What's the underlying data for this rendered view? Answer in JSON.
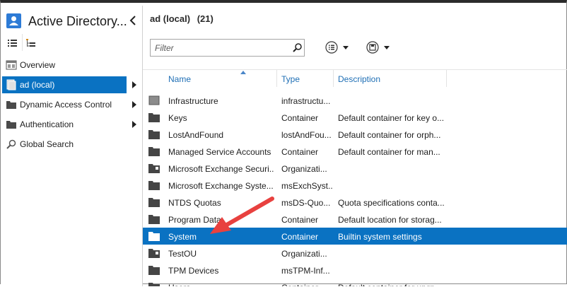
{
  "app": {
    "title": "Active Directory...",
    "collapse_glyph": "‹"
  },
  "nav": {
    "view_toggles": [
      "list-view-icon",
      "tree-view-icon"
    ],
    "items": [
      {
        "label": "Overview",
        "icon": "overview-icon",
        "has_arrow": false,
        "selected": false
      },
      {
        "label": "ad (local)",
        "icon": "domain-icon",
        "has_arrow": true,
        "selected": true
      },
      {
        "label": "Dynamic Access Control",
        "icon": "folder-icon",
        "has_arrow": true,
        "selected": false
      },
      {
        "label": "Authentication",
        "icon": "folder-icon",
        "has_arrow": true,
        "selected": false
      },
      {
        "label": "Global Search",
        "icon": "search-icon",
        "has_arrow": false,
        "selected": false
      }
    ]
  },
  "main": {
    "header_title": "ad (local)",
    "header_count": "(21)",
    "filter_placeholder": "Filter",
    "columns": {
      "name": "Name",
      "type": "Type",
      "description": "Description"
    },
    "rows": [
      {
        "icon": "builtin-domain-icon",
        "name": "Infrastructure",
        "type": "infrastructu...",
        "description": "",
        "selected": false
      },
      {
        "icon": "folder-icon",
        "name": "Keys",
        "type": "Container",
        "description": "Default container for key o...",
        "selected": false
      },
      {
        "icon": "folder-icon",
        "name": "LostAndFound",
        "type": "lostAndFou...",
        "description": "Default container for orph...",
        "selected": false
      },
      {
        "icon": "folder-icon",
        "name": "Managed Service Accounts",
        "type": "Container",
        "description": "Default container for man...",
        "selected": false
      },
      {
        "icon": "ou-icon",
        "name": "Microsoft Exchange Securi...",
        "type": "Organizati...",
        "description": "",
        "selected": false
      },
      {
        "icon": "folder-icon",
        "name": "Microsoft Exchange Syste...",
        "type": "msExchSyst...",
        "description": "",
        "selected": false
      },
      {
        "icon": "folder-icon",
        "name": "NTDS Quotas",
        "type": "msDS-Quo...",
        "description": "Quota specifications conta...",
        "selected": false
      },
      {
        "icon": "folder-icon",
        "name": "Program Data",
        "type": "Container",
        "description": "Default location for storag...",
        "selected": false
      },
      {
        "icon": "folder-icon",
        "name": "System",
        "type": "Container",
        "description": "Builtin system settings",
        "selected": true
      },
      {
        "icon": "ou-icon",
        "name": "TestOU",
        "type": "Organizati...",
        "description": "",
        "selected": false
      },
      {
        "icon": "folder-icon",
        "name": "TPM Devices",
        "type": "msTPM-Inf...",
        "description": "",
        "selected": false
      },
      {
        "icon": "folder-icon",
        "name": "Users",
        "type": "Container",
        "description": "Default container for upgr...",
        "selected": false
      }
    ]
  },
  "colors": {
    "selection": "#0a72c2",
    "column_header": "#1f6fb5",
    "annotation_arrow": "#e8413f"
  }
}
